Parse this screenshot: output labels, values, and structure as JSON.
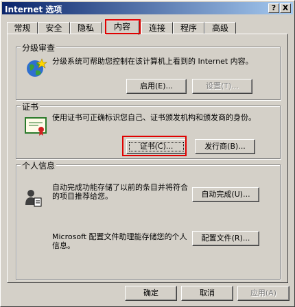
{
  "window": {
    "title": "Internet 选项",
    "help_glyph": "?",
    "close_glyph": "X"
  },
  "tabs": [
    {
      "label": "常规"
    },
    {
      "label": "安全"
    },
    {
      "label": "隐私"
    },
    {
      "label": "内容"
    },
    {
      "label": "连接"
    },
    {
      "label": "程序"
    },
    {
      "label": "高级"
    }
  ],
  "rating_group": {
    "title": "分级审查",
    "description": "分级系统可帮助您控制在该计算机上看到的 Internet 内容。",
    "enable_label": "启用(E)...",
    "settings_label": "设置(T)..."
  },
  "cert_group": {
    "title": "证书",
    "description": "使用证书可正确标识您自己、证书颁发机构和颁发商的身份。",
    "certificates_label": "证书(C)...",
    "publishers_label": "发行商(B)..."
  },
  "personal_group": {
    "title": "个人信息",
    "autocomplete_description": "自动完成功能存储了以前的条目并将符合的项目推荐给您。",
    "autocomplete_label": "自动完成(U)...",
    "profile_description": "Microsoft 配置文件助理能存储您的个人信息。",
    "profile_label": "配置文件(R)..."
  },
  "footer": {
    "ok_label": "确定",
    "cancel_label": "取消",
    "apply_label": "应用(A)"
  },
  "highlight_color": "#e00000"
}
